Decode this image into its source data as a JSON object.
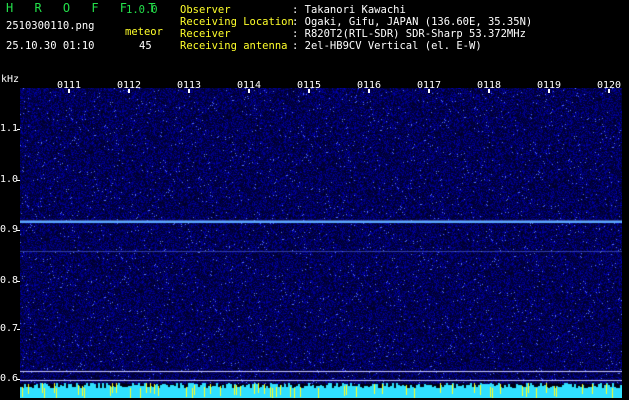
{
  "header": {
    "app_title": "H R O F F T",
    "version": "1.0.0",
    "filename": "2510300110.png",
    "datetime": "25.10.30 01:10",
    "count_label": "meteor",
    "count_value": "45",
    "info_labels": [
      "Observer",
      "Receiving Location",
      "Receiver",
      "Receiving antenna"
    ],
    "info_values": [
      ": Takanori Kawachi",
      ": Ogaki, Gifu, JAPAN (136.60E, 35.35N)",
      ": R820T2(RTL-SDR) SDR-Sharp 53.372MHz",
      ": 2el-HB9CV Vertical (el. E-W)"
    ]
  },
  "spectrogram": {
    "y_unit": "kHz",
    "y_ticks": [
      "1.1",
      "1.0",
      "0.9",
      "0.8",
      "0.7",
      "0.6"
    ],
    "x_ticks": [
      "0111",
      "0112",
      "0113",
      "0114",
      "0115",
      "0116",
      "0117",
      "0118",
      "0119",
      "0120"
    ],
    "colors": {
      "background": "#000000",
      "noise_low": "#0a0a55",
      "noise_high": "#3a3aff",
      "carrier": "#5aa8ff",
      "bottom_bar": "#30e0ff",
      "bottom_spike": "#ffff20",
      "header_green": "#23e04a",
      "header_yellow": "#ffff2a"
    }
  }
}
